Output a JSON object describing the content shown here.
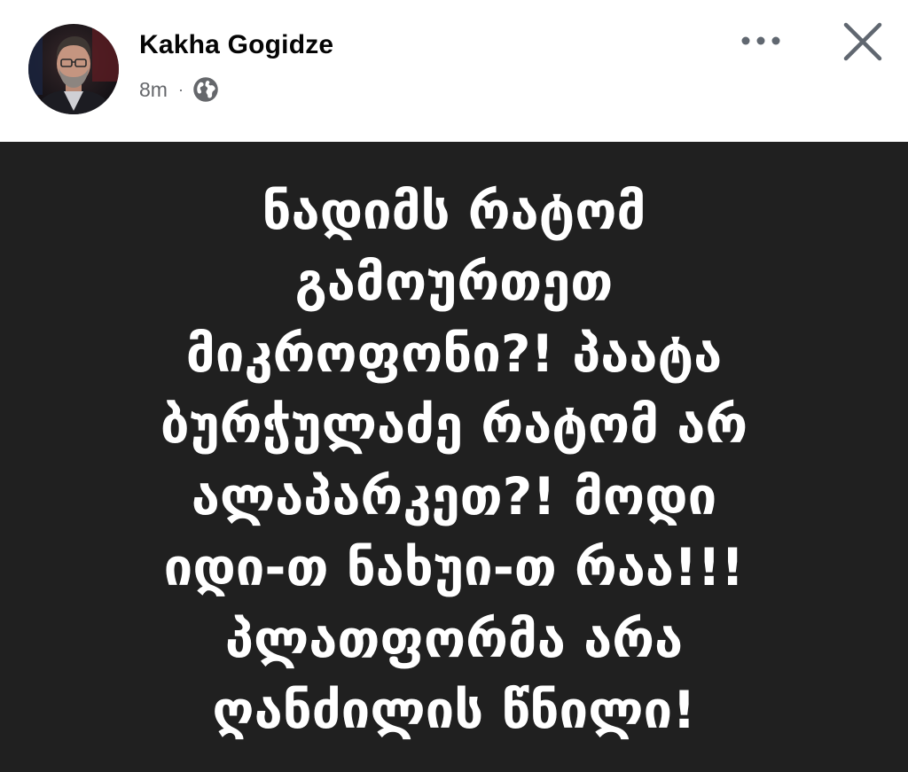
{
  "post": {
    "author": {
      "name": "Kakha Gogidze",
      "avatar_icon": "profile-photo"
    },
    "meta": {
      "time": "8m",
      "separator": "·",
      "audience_icon": "globe-icon"
    },
    "actions": {
      "more_icon": "more-horizontal-icon",
      "close_icon": "close-icon"
    },
    "image": {
      "background_color": "#202020",
      "text_color": "#ffffff",
      "text": "ნადიმს რატომ\nგამოურთეთ\nმიკროფონი?! პაატა\nბურჭულაძე რატომ არ\nალაპარკეთ?! მოდი\nიდი-თ  ნახუი-თ რაა!!!\nპლათფორმა არა\nღანძილის წნილი!"
    }
  }
}
